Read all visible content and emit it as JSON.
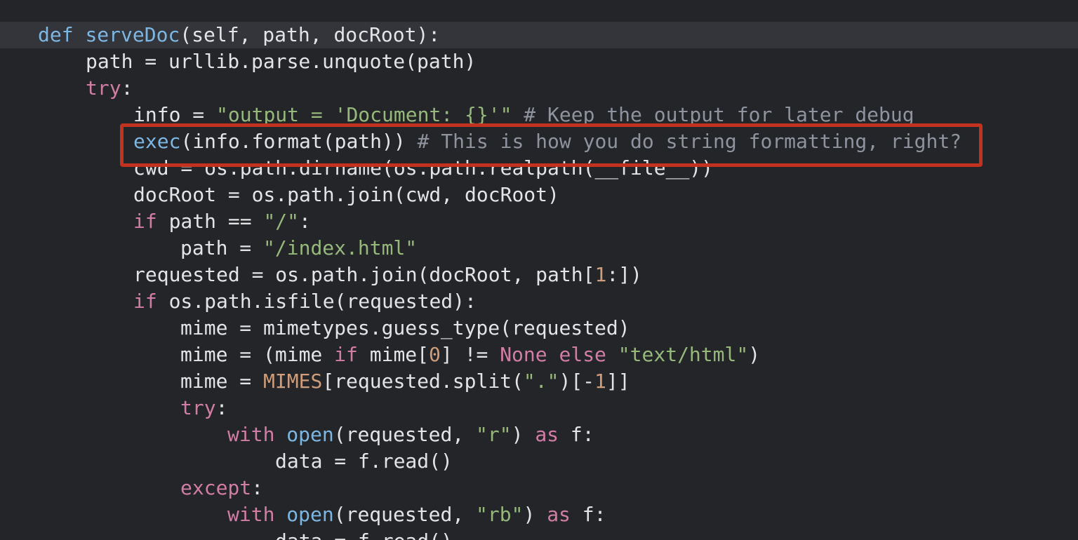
{
  "colors": {
    "background": "#242528",
    "current_line": "#34353a",
    "keyword": "#d27da5",
    "function": "#7cb7e3",
    "string": "#96b97b",
    "comment": "#8e939e",
    "number": "#cf9d7b",
    "plain": "#e4e4e6",
    "highlight_border": "#c3321f"
  },
  "lines": [
    {
      "kw": "def",
      "fn": "serveDoc",
      "rest": "(self, path, docRoot):"
    },
    {
      "plain": "path = urllib.parse.unquote(path)"
    },
    {
      "kw": "try",
      "rest": ":"
    },
    {
      "pre": "info = ",
      "str": "\"output = 'Document: {}'\"",
      "cmt": " # Keep the output for later debug"
    },
    {
      "fn": "exec",
      "rest": "(info.format(path))",
      "cmt": " # This is how you do string formatting, right?"
    },
    {
      "plain": "cwd = os.path.dirname(os.path.realpath(__file__))"
    },
    {
      "plain": "docRoot = os.path.join(cwd, docRoot)"
    },
    {
      "kw": "if",
      "pre": " path == ",
      "str": "\"/\"",
      "rest": ":"
    },
    {
      "pre": "path = ",
      "str": "\"/index.html\""
    },
    {
      "pre": "requested = os.path.join(docRoot, path[",
      "num": "1",
      "rest": ":])"
    },
    {
      "kw": "if",
      "rest": " os.path.isfile(requested):"
    },
    {
      "plain": "mime = mimetypes.guess_type(requested)"
    },
    {
      "pre": "mime = (mime ",
      "kw1": "if",
      "mid": " mime[",
      "num": "0",
      "mid2": "] != ",
      "kw2": "None",
      "sp": " ",
      "kw3": "else",
      "sp2": " ",
      "str": "\"text/html\"",
      "rest": ")"
    },
    {
      "pre": "mime = ",
      "cls": "MIMES",
      "mid": "[requested.split(",
      "str": "\".\"",
      "mid2": ")[-",
      "num": "1",
      "rest": "]]"
    },
    {
      "kw": "try",
      "rest": ":"
    },
    {
      "kw": "with",
      "sp": " ",
      "fn": "open",
      "mid": "(requested, ",
      "str": "\"r\"",
      "mid2": ") ",
      "kw2": "as",
      "rest": " f:"
    },
    {
      "plain": "data = f.read()"
    },
    {
      "kw": "except",
      "rest": ":"
    },
    {
      "kw": "with",
      "sp": " ",
      "fn": "open",
      "mid": "(requested, ",
      "str": "\"rb\"",
      "mid2": ") ",
      "kw2": "as",
      "rest": " f:"
    },
    {
      "plain": "data = f.read()"
    }
  ]
}
